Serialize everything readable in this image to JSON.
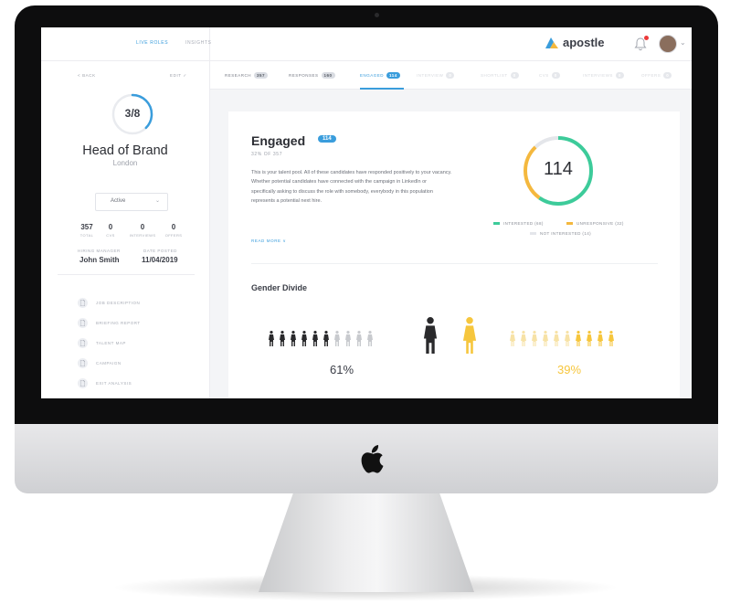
{
  "topbar": {
    "nav": [
      "LIVE ROLES",
      "INSIGHTS"
    ],
    "brand_name": "apostle"
  },
  "sidebar": {
    "back_label": "< BACK",
    "edit_label": "EDIT ✓",
    "progress_label": "3/8",
    "progress_fraction": 0.375,
    "role_title": "Head of Brand",
    "location": "London",
    "status_value": "Active",
    "stats": [
      {
        "value": "357",
        "label": "TOTAL"
      },
      {
        "value": "0",
        "label": "CVS"
      },
      {
        "value": "0",
        "label": "INTERVIEWS"
      },
      {
        "value": "0",
        "label": "OFFERS"
      }
    ],
    "hiring_manager_label": "HIRING MANAGER",
    "hiring_manager": "John Smith",
    "date_posted_label": "DATE POSTED",
    "date_posted": "11/04/2019",
    "documents": [
      "JOB DESCRIPTION",
      "BRIEFING REPORT",
      "TALENT MAP",
      "CAMPAIGN",
      "EXIT ANALYSIS"
    ]
  },
  "tabs": [
    {
      "label": "RESEARCH",
      "count": "357",
      "state": "done"
    },
    {
      "label": "RESPONSES",
      "count": "160",
      "state": "done"
    },
    {
      "label": "ENGAGED",
      "count": "114",
      "state": "active"
    },
    {
      "label": "INTERVIEW",
      "count": "0",
      "state": "faded"
    },
    {
      "label": "SHORTLIST",
      "count": "0",
      "state": "faded"
    },
    {
      "label": "CVS",
      "count": "0",
      "state": "faded"
    },
    {
      "label": "INTERVIEWS",
      "count": "0",
      "state": "faded"
    },
    {
      "label": "OFFERS",
      "count": "0",
      "state": "faded"
    }
  ],
  "main": {
    "title": "Engaged",
    "badge": "114",
    "subtitle": "32% OF 357",
    "description": "This is your talent pool. All of these candidates have responded positively to your vacancy. Whether potential candidates have connected with the campaign in LinkedIn or specifically asking to discuss the role with somebody, everybody in this population represents a potential next hire.",
    "read_more": "READ MORE ∨",
    "donut_total": "114",
    "legend": [
      {
        "label": "INTERESTED (68)",
        "value": 68,
        "color": "#3dcb9a"
      },
      {
        "label": "UNRESPONSIVE (32)",
        "value": 32,
        "color": "#f4b83e"
      },
      {
        "label": "NOT INTERESTED (14)",
        "value": 14,
        "color": "#e4e6ea"
      }
    ],
    "gender_title": "Gender Divide",
    "male_pct": "61%",
    "female_pct": "39%",
    "male_color": "#2a2a2c",
    "female_color": "#f6c63d"
  }
}
